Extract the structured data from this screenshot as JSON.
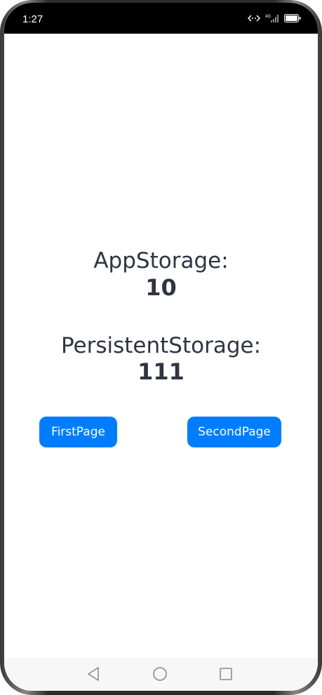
{
  "status_bar": {
    "time": "1:27",
    "signal_label": "4G"
  },
  "main": {
    "app_storage_label": "AppStorage:",
    "app_storage_value": "10",
    "persistent_storage_label": "PersistentStorage:",
    "persistent_storage_value": "111"
  },
  "buttons": {
    "first_page": "FirstPage",
    "second_page": "SecondPage"
  },
  "nav_bar": {
    "icons": [
      "back-icon",
      "home-icon",
      "recent-apps-icon"
    ]
  },
  "colors": {
    "button_bg": "#007dff",
    "text": "#2e3542",
    "status_bar_bg": "#000000"
  }
}
